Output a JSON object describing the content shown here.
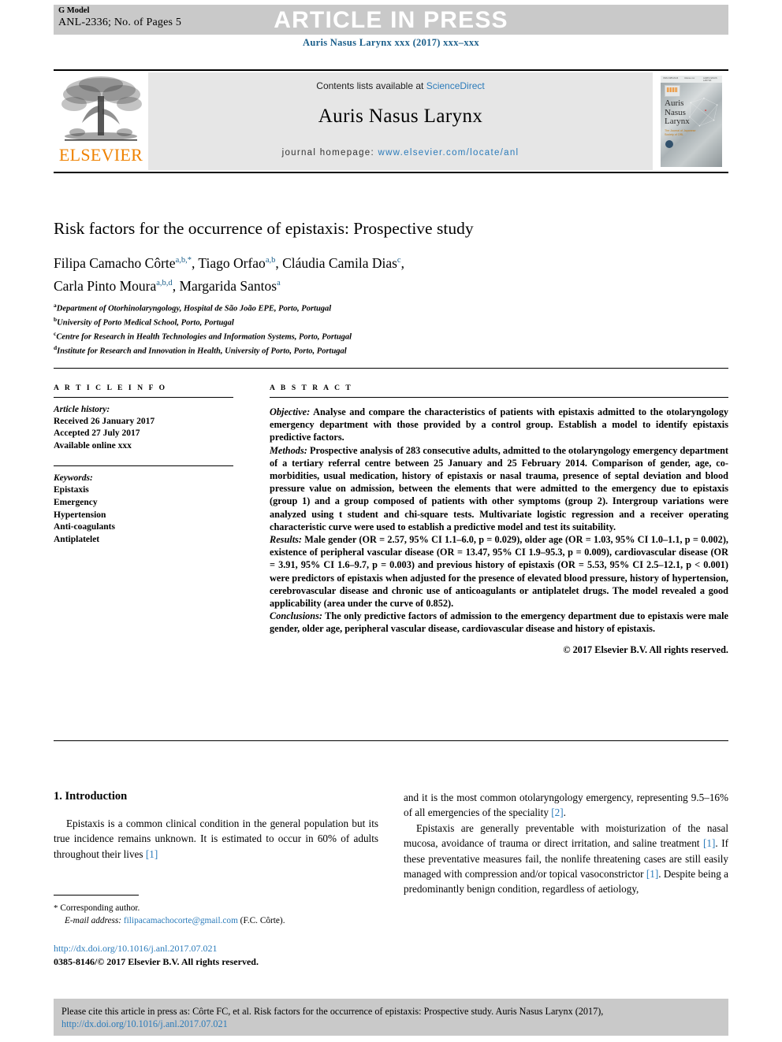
{
  "header": {
    "g_model": "G Model",
    "manuscript_id": "ANL-2336; No. of Pages 5",
    "press_banner": "ARTICLE IN PRESS",
    "journal_ref": "Auris Nasus Larynx xxx (2017) xxx–xxx"
  },
  "masthead": {
    "publisher": "ELSEVIER",
    "contents_prefix": "Contents lists available at ",
    "contents_link": "ScienceDirect",
    "journal_name": "Auris Nasus Larynx",
    "homepage_label": "journal homepage: ",
    "homepage_url": "www.elsevier.com/locate/anl",
    "cover": {
      "title_line1": "Auris",
      "title_line2": "Nasus",
      "title_line3": "Larynx",
      "subtitle": "The Journal of Japanese Society of ORL",
      "topbar_left": "ISSN 0385-8146",
      "topbar_center": "Volume xxx",
      "topbar_right": "AURIS NASUS LARYNX"
    }
  },
  "article": {
    "title": "Risk factors for the occurrence of epistaxis: Prospective study",
    "authors": [
      {
        "name": "Filipa Camacho Côrte",
        "marks": "a,b,",
        "star": true
      },
      {
        "name": "Tiago Orfao",
        "marks": "a,b",
        "star": false
      },
      {
        "name": "Cláudia Camila Dias",
        "marks": "c",
        "star": false
      },
      {
        "name": "Carla Pinto Moura",
        "marks": "a,b,d",
        "star": false
      },
      {
        "name": "Margarida Santos",
        "marks": "a",
        "star": false
      }
    ],
    "affiliations": [
      {
        "mark": "a",
        "text": "Department of Otorhinolaryngology, Hospital de São João EPE, Porto, Portugal"
      },
      {
        "mark": "b",
        "text": "University of Porto Medical School, Porto, Portugal"
      },
      {
        "mark": "c",
        "text": "Centre for Research in Health Technologies and Information Systems, Porto, Portugal"
      },
      {
        "mark": "d",
        "text": "Institute for Research and Innovation in Health, University of Porto, Porto, Portugal"
      }
    ]
  },
  "article_info": {
    "label": "A R T I C L E   I N F O",
    "history_label": "Article history:",
    "received": "Received 26 January 2017",
    "accepted": "Accepted 27 July 2017",
    "available": "Available online xxx",
    "keywords_label": "Keywords:",
    "keywords": [
      "Epistaxis",
      "Emergency",
      "Hypertension",
      "Anti-coagulants",
      "Antiplatelet"
    ]
  },
  "abstract": {
    "label": "A B S T R A C T",
    "objective_label": "Objective:",
    "objective_text": " Analyse and compare the characteristics of patients with epistaxis admitted to the otolaryngology emergency department with those provided by a control group. Establish a model to identify epistaxis predictive factors.",
    "methods_label": "Methods:",
    "methods_text": " Prospective analysis of 283 consecutive adults, admitted to the otolaryngology emergency department of a tertiary referral centre between 25 January and 25 February 2014. Comparison of gender, age, co-morbidities, usual medication, history of epistaxis or nasal trauma, presence of septal deviation and blood pressure value on admission, between the elements that were admitted to the emergency due to epistaxis (group 1) and a group composed of patients with other symptoms (group 2). Intergroup variations were analyzed using t student and chi-square tests. Multivariate logistic regression and a receiver operating characteristic curve were used to establish a predictive model and test its suitability.",
    "results_label": "Results:",
    "results_text": " Male gender (OR = 2.57, 95% CI 1.1–6.0, p = 0.029), older age (OR = 1.03, 95% CI 1.0–1.1, p = 0.002), existence of peripheral vascular disease (OR = 13.47, 95% CI 1.9–95.3, p = 0.009), cardiovascular disease (OR = 3.91, 95% CI 1.6–9.7, p = 0.003) and previous history of epistaxis (OR = 5.53, 95% CI 2.5–12.1, p < 0.001) were predictors of epistaxis when adjusted for the presence of elevated blood pressure, history of hypertension, cerebrovascular disease and chronic use of anticoagulants or antiplatelet drugs. The model revealed a good applicability (area under the curve of 0.852).",
    "conclusions_label": "Conclusions:",
    "conclusions_text": " The only predictive factors of admission to the emergency department due to epistaxis were male gender, older age, peripheral vascular disease, cardiovascular disease and history of epistaxis.",
    "copyright": "© 2017 Elsevier B.V. All rights reserved."
  },
  "introduction": {
    "heading": "1. Introduction",
    "par1_a": "Epistaxis is a common clinical condition in the general population but its true incidence remains unknown. It is estimated to occur in 60% of adults throughout their lives ",
    "par1_ref1": "[1]",
    "par1_b": "and it is the most common otolaryngology emergency, representing 9.5–16% of all emergencies of the speciality ",
    "par1_ref2": "[2]",
    "par1_c": ".",
    "par2_a": "Epistaxis are generally preventable with moisturization of the nasal mucosa, avoidance of trauma or direct irritation, and saline treatment ",
    "par2_ref1": "[1]",
    "par2_b": ". If these preventative measures fail, the nonlife threatening cases are still easily managed with compression and/or topical vasoconstrictor ",
    "par2_ref2": "[1]",
    "par2_c": ". Despite being a predominantly benign condition, regardless of aetiology,"
  },
  "footer": {
    "corresponding_marker": "*",
    "corresponding_label": " Corresponding author.",
    "email_label": "E-mail address:",
    "email": "filipacamachocorte@gmail.com",
    "email_suffix": " (F.C. Côrte).",
    "doi": "http://dx.doi.org/10.1016/j.anl.2017.07.021",
    "issn": "0385-8146/© 2017 Elsevier B.V. All rights reserved."
  },
  "cite_box": {
    "line1": "Please cite this article in press as: Côrte FC, et al. Risk factors for the occurrence of epistaxis: Prospective study. Auris Nasus Larynx (2017),",
    "line2": "http://dx.doi.org/10.1016/j.anl.2017.07.021"
  },
  "colors": {
    "link": "#2b7bba",
    "journal_ref": "#1a5e8a",
    "elsevier_orange": "#ef8200",
    "banner_gray": "#c9c9c9",
    "panel_gray": "#e6e6e6"
  }
}
